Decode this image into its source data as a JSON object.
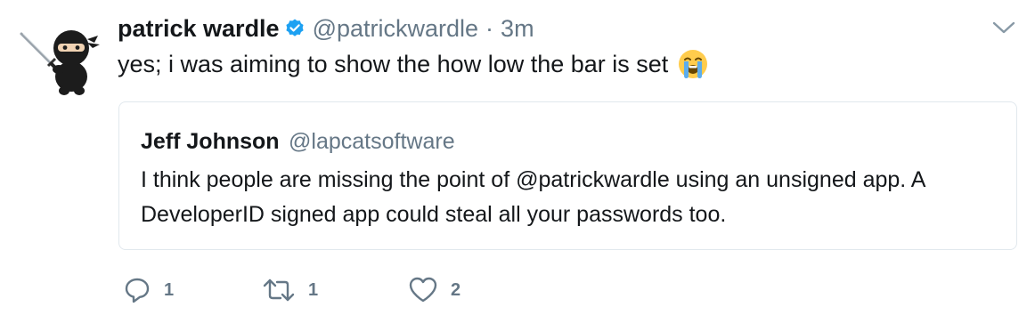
{
  "tweet": {
    "author_name": "patrick wardle",
    "handle": "@patrickwardle",
    "separator": "·",
    "time": "3m",
    "text": "yes; i was aiming to show the how low the bar is set",
    "verified": true
  },
  "quoted_tweet": {
    "author_name": "Jeff Johnson",
    "handle": "@lapcatsoftware",
    "text": "I think people are missing the point of @patrickwardle using an unsigned app. A DeveloperID signed app could steal all your passwords too."
  },
  "actions": {
    "reply_count": "1",
    "retweet_count": "1",
    "like_count": "2"
  },
  "icons": {
    "reply": "reply-icon",
    "retweet": "retweet-icon",
    "like": "heart-icon",
    "verified": "verified-badge-icon",
    "menu": "chevron-down-icon",
    "emoji": "loudly-crying-face-emoji"
  },
  "colors": {
    "text": "#14171a",
    "secondary": "#657786",
    "verified": "#1da1f2",
    "border": "#e1e8ed"
  }
}
